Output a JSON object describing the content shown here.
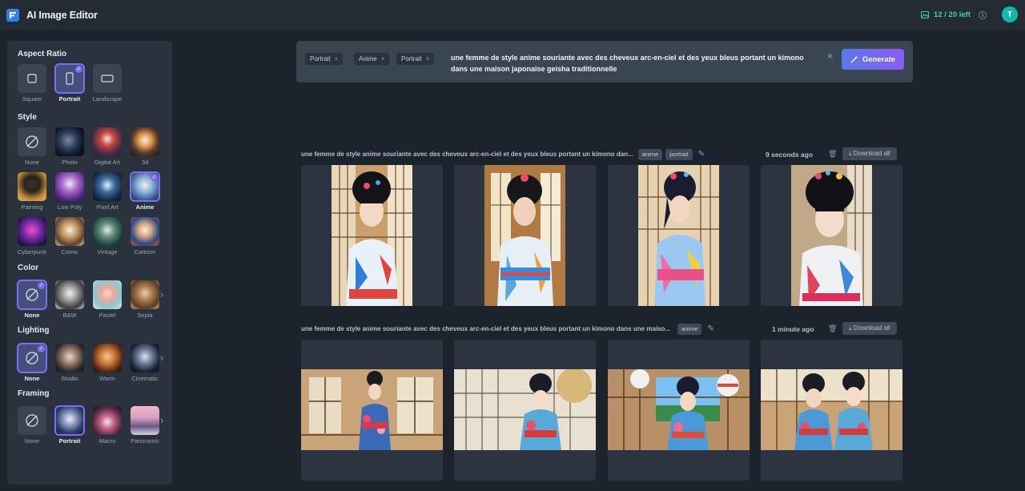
{
  "app": {
    "title": "AI Image Editor"
  },
  "credits": {
    "text": "12 / 20 left"
  },
  "user": {
    "initial": "T"
  },
  "colors": {
    "accent": "#7b6ef6",
    "credits": "#46d39a",
    "avatar": "#14b8a6",
    "generate_from": "#5a78e6",
    "generate_to": "#8b5cf6"
  },
  "sidebar": {
    "aspect": {
      "title": "Aspect Ratio",
      "options": [
        {
          "label": "Square",
          "icon": "square-icon"
        },
        {
          "label": "Portrait",
          "icon": "portrait-icon",
          "selected": true
        },
        {
          "label": "Landscape",
          "icon": "landscape-icon"
        }
      ]
    },
    "style": {
      "title": "Style",
      "rows": [
        [
          {
            "label": "None"
          },
          {
            "label": "Photo"
          },
          {
            "label": "Digital Art"
          },
          {
            "label": "3d"
          }
        ],
        [
          {
            "label": "Painting"
          },
          {
            "label": "Low Poly"
          },
          {
            "label": "Pixel Art"
          },
          {
            "label": "Anime",
            "selected": true
          }
        ],
        [
          {
            "label": "Cyberpunk"
          },
          {
            "label": "Comic"
          },
          {
            "label": "Vintage"
          },
          {
            "label": "Cartoon"
          }
        ]
      ]
    },
    "color": {
      "title": "Color",
      "options": [
        {
          "label": "None",
          "selected": true
        },
        {
          "label": "B&W"
        },
        {
          "label": "Pastel"
        },
        {
          "label": "Sepia"
        }
      ]
    },
    "lighting": {
      "title": "Lighting",
      "options": [
        {
          "label": "None",
          "selected": true
        },
        {
          "label": "Studio"
        },
        {
          "label": "Warm"
        },
        {
          "label": "Cinematic"
        }
      ]
    },
    "framing": {
      "title": "Framing",
      "options": [
        {
          "label": "None"
        },
        {
          "label": "Portrait",
          "selected": true
        },
        {
          "label": "Macro"
        },
        {
          "label": "Panoramic"
        }
      ]
    }
  },
  "prompt": {
    "tags": [
      "Portrait",
      "Anime",
      "Portrait"
    ],
    "text": "une femme de style anime souriante avec des cheveux arc-en-ciel et des yeux bleus portant un kimono dans une maison japonaise geisha traditionnelle",
    "generate_label": "Generate"
  },
  "generations": [
    {
      "prompt": "une femme de style anime souriante avec des cheveux arc-en-ciel et des yeux bleus portant un kimono dan...",
      "chips": [
        "anime",
        "portrait"
      ],
      "time": "9 seconds ago",
      "download_label": "Download all"
    },
    {
      "prompt": "une femme de style anime souriante avec des cheveux arc-en-ciel et des yeux bleus portant un kimono dans une maiso...",
      "chips": [
        "anime"
      ],
      "time": "1 minute ago",
      "download_label": "Download all"
    }
  ]
}
